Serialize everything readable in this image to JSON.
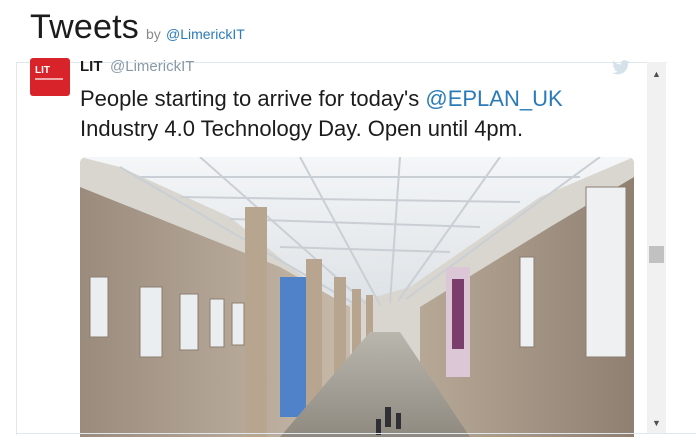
{
  "header": {
    "title": "Tweets",
    "by": "by",
    "handle": "@LimerickIT"
  },
  "tweet": {
    "avatar_text": "LIT",
    "author_name": "LIT",
    "author_handle": "@LimerickIT",
    "text_before": "People starting to arrive for today's ",
    "mention": "@EPLAN_UK",
    "text_after": " Industry 4.0 Technology Day. Open until 4pm."
  },
  "icons": {
    "bird": "twitter-bird-icon",
    "scroll_up": "scroll-up-arrow-icon",
    "scroll_down": "scroll-down-arrow-icon"
  },
  "colors": {
    "link": "#2b7bb9",
    "avatar_bg": "#d8232a",
    "muted": "#8899a6"
  }
}
